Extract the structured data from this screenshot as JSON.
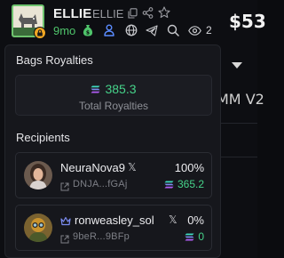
{
  "header": {
    "token_name": "ELLIE",
    "ticker": "ELLIE",
    "age": "9mo",
    "watchers": "2"
  },
  "background": {
    "price": "$53",
    "pool_label": "MM V2"
  },
  "popover": {
    "title": "Bags Royalties",
    "total_value": "385.3",
    "total_caption": "Total Royalties",
    "recipients_title": "Recipients",
    "recipients": [
      {
        "name": "NeuraNova9",
        "x_glyph": "𝕏",
        "percent": "100%",
        "address": "DNJA...fGAj",
        "amount": "365.2",
        "amount_color": "#46d38a"
      },
      {
        "name": "ronweasley_sol",
        "x_glyph": "𝕏",
        "percent": "0%",
        "address": "9beR...9BFp",
        "amount": "0",
        "amount_color": "#46d38a"
      }
    ]
  },
  "colors": {
    "accent_green": "#46d38a",
    "age_green": "#4fc46b",
    "icon_blue": "#5b8cff",
    "badge_orange": "#f0a623"
  }
}
